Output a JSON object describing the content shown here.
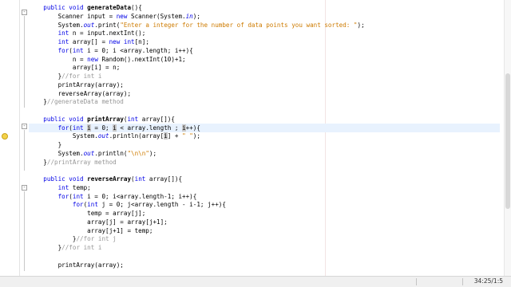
{
  "editor": {
    "lines": [
      {
        "indent": "    ",
        "tokens": [
          {
            "t": "public void ",
            "c": "kw"
          },
          {
            "t": "generateData",
            "c": "fn"
          },
          {
            "t": "(){"
          }
        ]
      },
      {
        "indent": "        ",
        "tokens": [
          {
            "t": "Scanner input = "
          },
          {
            "t": "new",
            "c": "kw"
          },
          {
            "t": " Scanner(System."
          },
          {
            "t": "in",
            "c": "st"
          },
          {
            "t": ");"
          }
        ]
      },
      {
        "indent": "        ",
        "tokens": [
          {
            "t": "System."
          },
          {
            "t": "out",
            "c": "st"
          },
          {
            "t": ".print("
          },
          {
            "t": "\"Enter a integer for the number of data points you want sorted: \"",
            "c": "str"
          },
          {
            "t": ");"
          }
        ]
      },
      {
        "indent": "        ",
        "tokens": [
          {
            "t": "int",
            "c": "kw"
          },
          {
            "t": " n = input.nextInt();"
          }
        ]
      },
      {
        "indent": "        ",
        "tokens": [
          {
            "t": "int",
            "c": "kw"
          },
          {
            "t": " array[] = "
          },
          {
            "t": "new int",
            "c": "kw"
          },
          {
            "t": "[n];"
          }
        ]
      },
      {
        "indent": "        ",
        "tokens": [
          {
            "t": "for",
            "c": "kw"
          },
          {
            "t": "("
          },
          {
            "t": "int",
            "c": "kw"
          },
          {
            "t": " i = 0; i <array.length; i++){"
          }
        ]
      },
      {
        "indent": "            ",
        "tokens": [
          {
            "t": "n = "
          },
          {
            "t": "new",
            "c": "kw"
          },
          {
            "t": " Random().nextInt(10)+1;"
          }
        ]
      },
      {
        "indent": "            ",
        "tokens": [
          {
            "t": "array[i] = n;"
          }
        ]
      },
      {
        "indent": "        ",
        "tokens": [
          {
            "t": "}"
          },
          {
            "t": "//for int i",
            "c": "cm"
          }
        ]
      },
      {
        "indent": "        ",
        "tokens": [
          {
            "t": "printArray(array);"
          }
        ]
      },
      {
        "indent": "        ",
        "tokens": [
          {
            "t": "reverseArray(array);"
          }
        ]
      },
      {
        "indent": "    ",
        "tokens": [
          {
            "t": "}"
          },
          {
            "t": "//generateData method",
            "c": "cm"
          }
        ]
      },
      {
        "indent": "",
        "tokens": [
          {
            "t": ""
          }
        ]
      },
      {
        "indent": "    ",
        "tokens": [
          {
            "t": "public void ",
            "c": "kw"
          },
          {
            "t": "printArray",
            "c": "fn"
          },
          {
            "t": "("
          },
          {
            "t": "int",
            "c": "kw"
          },
          {
            "t": " array[]){"
          }
        ]
      },
      {
        "indent": "        ",
        "current": true,
        "tokens": [
          {
            "t": "for",
            "c": "kw"
          },
          {
            "t": "("
          },
          {
            "t": "int",
            "c": "kw"
          },
          {
            "t": " "
          },
          {
            "t": "i",
            "c": "occ"
          },
          {
            "t": " = 0; "
          },
          {
            "t": "i",
            "c": "occ"
          },
          {
            "t": " < array.length ; "
          },
          {
            "t": "i",
            "c": "occ"
          },
          {
            "t": "++){"
          }
        ]
      },
      {
        "indent": "            ",
        "tokens": [
          {
            "t": "System."
          },
          {
            "t": "out",
            "c": "st"
          },
          {
            "t": ".println(array["
          },
          {
            "t": "i",
            "c": "occ"
          },
          {
            "t": "] + "
          },
          {
            "t": "\" \"",
            "c": "str"
          },
          {
            "t": ");"
          }
        ]
      },
      {
        "indent": "        ",
        "tokens": [
          {
            "t": "}"
          }
        ]
      },
      {
        "indent": "        ",
        "tokens": [
          {
            "t": "System."
          },
          {
            "t": "out",
            "c": "st"
          },
          {
            "t": ".println("
          },
          {
            "t": "\"\\n\\n\"",
            "c": "str"
          },
          {
            "t": ");"
          }
        ]
      },
      {
        "indent": "    ",
        "tokens": [
          {
            "t": "}"
          },
          {
            "t": "//printArray method",
            "c": "cm"
          }
        ]
      },
      {
        "indent": "",
        "tokens": [
          {
            "t": ""
          }
        ]
      },
      {
        "indent": "    ",
        "tokens": [
          {
            "t": "public void ",
            "c": "kw"
          },
          {
            "t": "reverseArray",
            "c": "fn"
          },
          {
            "t": "("
          },
          {
            "t": "int",
            "c": "kw"
          },
          {
            "t": " array[]){"
          }
        ]
      },
      {
        "indent": "        ",
        "tokens": [
          {
            "t": "int",
            "c": "kw"
          },
          {
            "t": " temp;"
          }
        ]
      },
      {
        "indent": "        ",
        "tokens": [
          {
            "t": "for",
            "c": "kw"
          },
          {
            "t": "("
          },
          {
            "t": "int",
            "c": "kw"
          },
          {
            "t": " i = 0; i<array.length-1; i++){"
          }
        ]
      },
      {
        "indent": "            ",
        "tokens": [
          {
            "t": "for",
            "c": "kw"
          },
          {
            "t": "("
          },
          {
            "t": "int",
            "c": "kw"
          },
          {
            "t": " j = 0; j<array.length - i-1; j++){"
          }
        ]
      },
      {
        "indent": "                ",
        "tokens": [
          {
            "t": "temp = array[j];"
          }
        ]
      },
      {
        "indent": "                ",
        "tokens": [
          {
            "t": "array[j] = array[j+1];"
          }
        ]
      },
      {
        "indent": "                ",
        "tokens": [
          {
            "t": "array[j+1] = temp;"
          }
        ]
      },
      {
        "indent": "            ",
        "tokens": [
          {
            "t": "}"
          },
          {
            "t": "//for int j",
            "c": "cm"
          }
        ]
      },
      {
        "indent": "        ",
        "tokens": [
          {
            "t": "}"
          },
          {
            "t": "//for int i",
            "c": "cm"
          }
        ]
      },
      {
        "indent": "",
        "tokens": [
          {
            "t": ""
          }
        ]
      },
      {
        "indent": "        ",
        "tokens": [
          {
            "t": "printArray(array);"
          }
        ]
      }
    ]
  },
  "statusbar": {
    "caret_position": "34:25/1:5"
  },
  "colors": {
    "keyword": "#0000e6",
    "string": "#ce7b00",
    "comment": "#969696",
    "current_line": "#e8f2fe"
  },
  "icons": {
    "hint": "lightbulb-icon",
    "fold": "fold-toggle-icon"
  }
}
